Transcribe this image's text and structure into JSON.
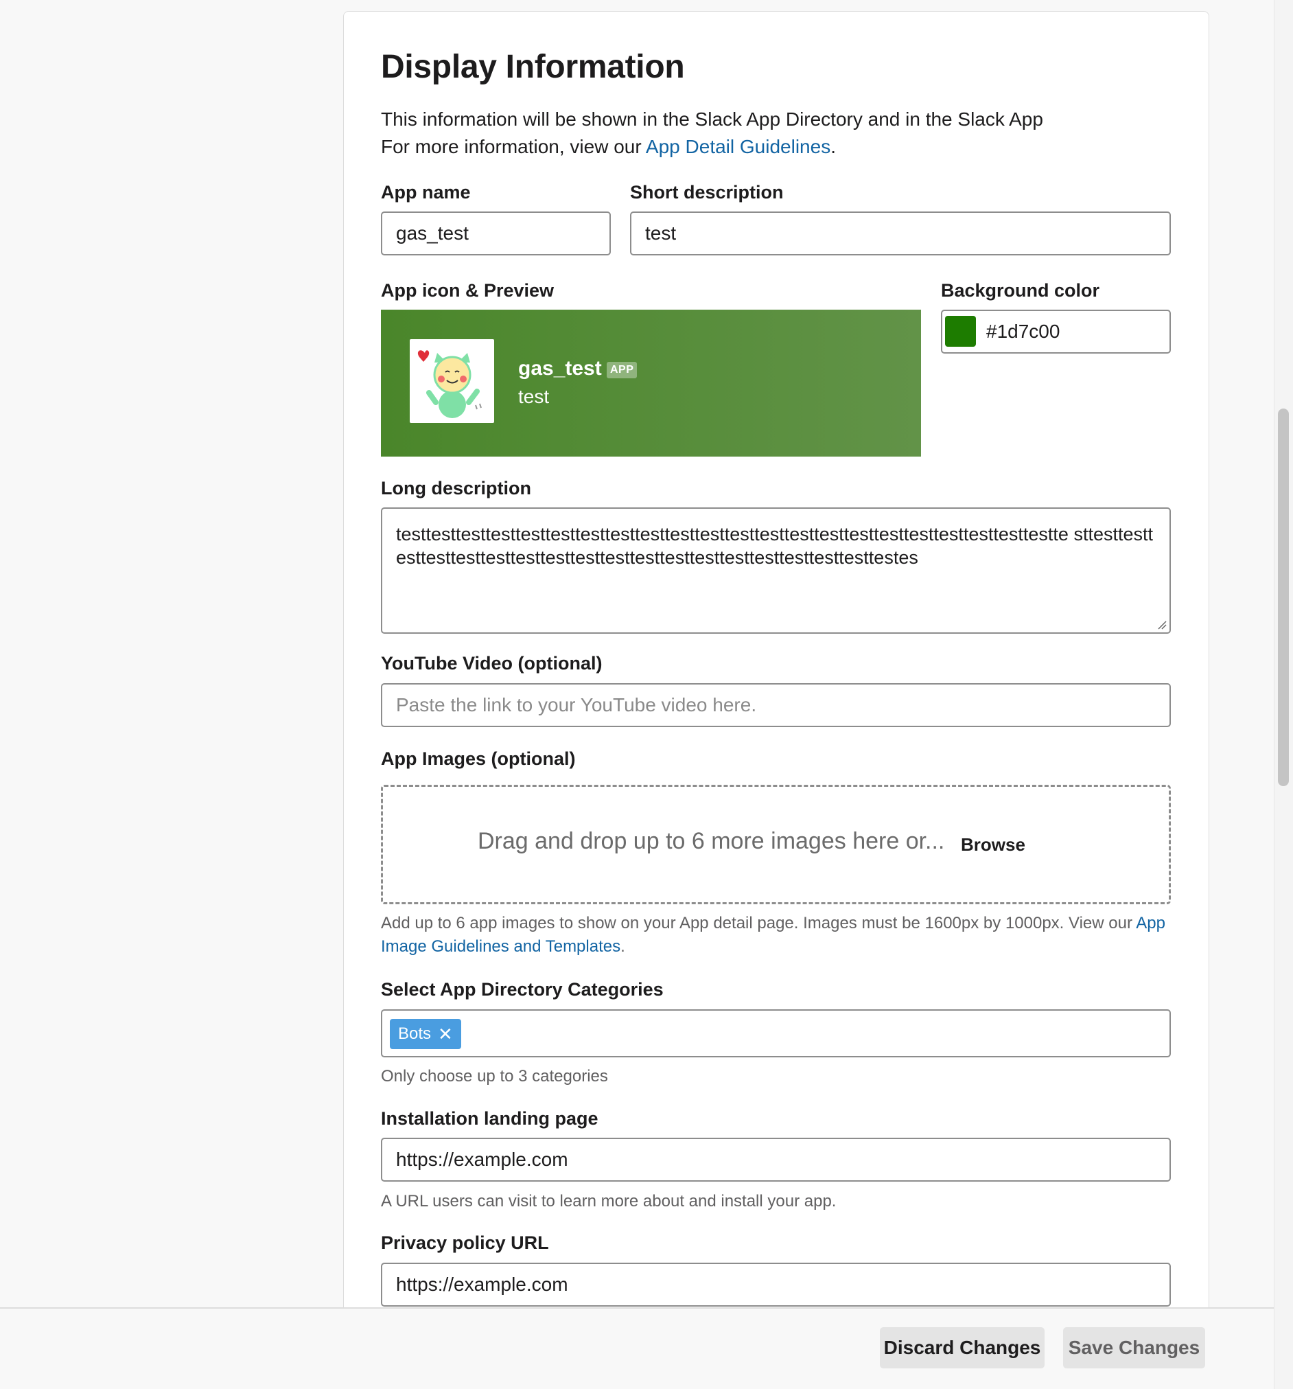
{
  "section": {
    "title": "Display Information",
    "intro_line1": "This information will be shown in the Slack App Directory and in the Slack App",
    "intro_line2_prefix": "For more information, view our ",
    "intro_link": "App Detail Guidelines",
    "intro_line2_suffix": "."
  },
  "app_name": {
    "label": "App name",
    "value": "gas_test"
  },
  "short_description": {
    "label": "Short description",
    "value": "test"
  },
  "preview": {
    "label": "App icon & Preview",
    "name": "gas_test",
    "badge": "APP",
    "description": "test"
  },
  "background_color": {
    "label": "Background color",
    "value": "#1d7c00",
    "swatch": "#1d7c00"
  },
  "long_description": {
    "label": "Long description",
    "value": "testtesttesttesttesttesttesttesttesttesttesttesttesttesttesttesttesttesttesttesttesttestte sttesttesttesttesttesttesttesttesttesttesttesttesttesttesttesttesttesttesttestes"
  },
  "youtube": {
    "label": "YouTube Video (optional)",
    "placeholder": "Paste the link to your YouTube video here."
  },
  "app_images": {
    "label": "App Images (optional)",
    "drop_text": "Drag and drop up to 6 more images here or...",
    "browse": "Browse",
    "hint_prefix": "Add up to 6 app images to show on your App detail page. Images must be 1600px by 1000px. View our ",
    "hint_link": "App Image Guidelines and Templates",
    "hint_suffix": "."
  },
  "categories": {
    "label": "Select App Directory Categories",
    "selected": [
      "Bots"
    ],
    "hint": "Only choose up to 3 categories"
  },
  "installation": {
    "label": "Installation landing page",
    "value": "https://example.com",
    "hint": "A URL users can visit to learn more about and install your app."
  },
  "privacy": {
    "label": "Privacy policy URL",
    "value": "https://example.com"
  },
  "footer": {
    "discard": "Discard Changes",
    "save": "Save Changes"
  },
  "colors": {
    "preview_bg_start": "#4a862a",
    "preview_bg_end": "#629348",
    "link": "#1264a3",
    "tag": "#4a9de0"
  }
}
